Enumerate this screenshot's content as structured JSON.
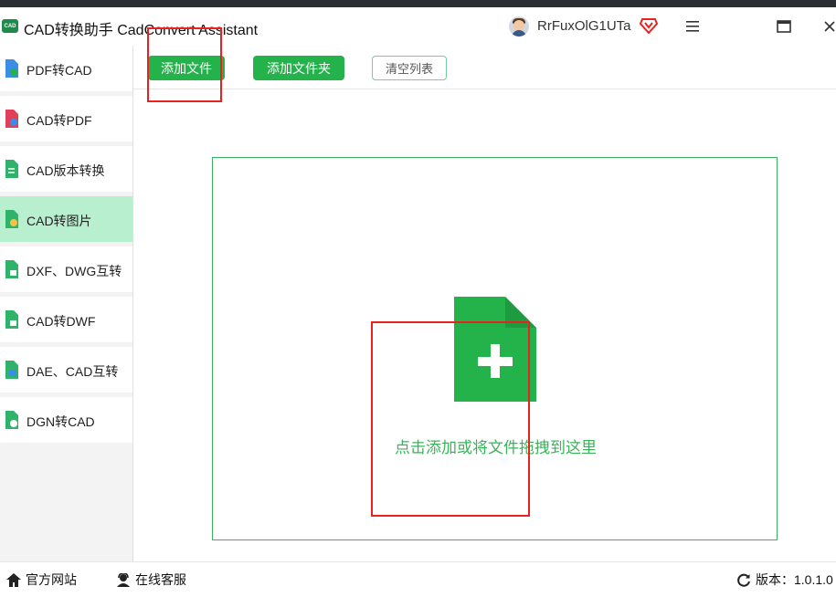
{
  "window": {
    "logo_text": "CAD",
    "title": "CAD转换助手 CadConvert Assistant",
    "username": "RrFuxOlG1UTa"
  },
  "sidebar": {
    "items": [
      {
        "label": "PDF转CAD",
        "icon": "pdf-to-cad-icon",
        "active": false
      },
      {
        "label": "CAD转PDF",
        "icon": "cad-to-pdf-icon",
        "active": false
      },
      {
        "label": "CAD版本转换",
        "icon": "cad-version-icon",
        "active": false
      },
      {
        "label": "CAD转图片",
        "icon": "cad-to-image-icon",
        "active": true
      },
      {
        "label": "DXF、DWG互转",
        "icon": "dxf-dwg-icon",
        "active": false
      },
      {
        "label": "CAD转DWF",
        "icon": "cad-to-dwf-icon",
        "active": false
      },
      {
        "label": "DAE、CAD互转",
        "icon": "dae-cad-icon",
        "active": false
      },
      {
        "label": "DGN转CAD",
        "icon": "dgn-to-cad-icon",
        "active": false
      }
    ]
  },
  "toolbar": {
    "add_file": "添加文件",
    "add_folder": "添加文件夹",
    "clear_list": "清空列表"
  },
  "dropzone": {
    "text": "点击添加或将文件拖拽到这里"
  },
  "footer": {
    "website": "官方网站",
    "service": "在线客服",
    "version": "版本：1.0.1.0"
  },
  "colors": {
    "accent_green": "#24b24a",
    "active_item": "#b8f0cf",
    "highlight_red": "#e8231f"
  }
}
